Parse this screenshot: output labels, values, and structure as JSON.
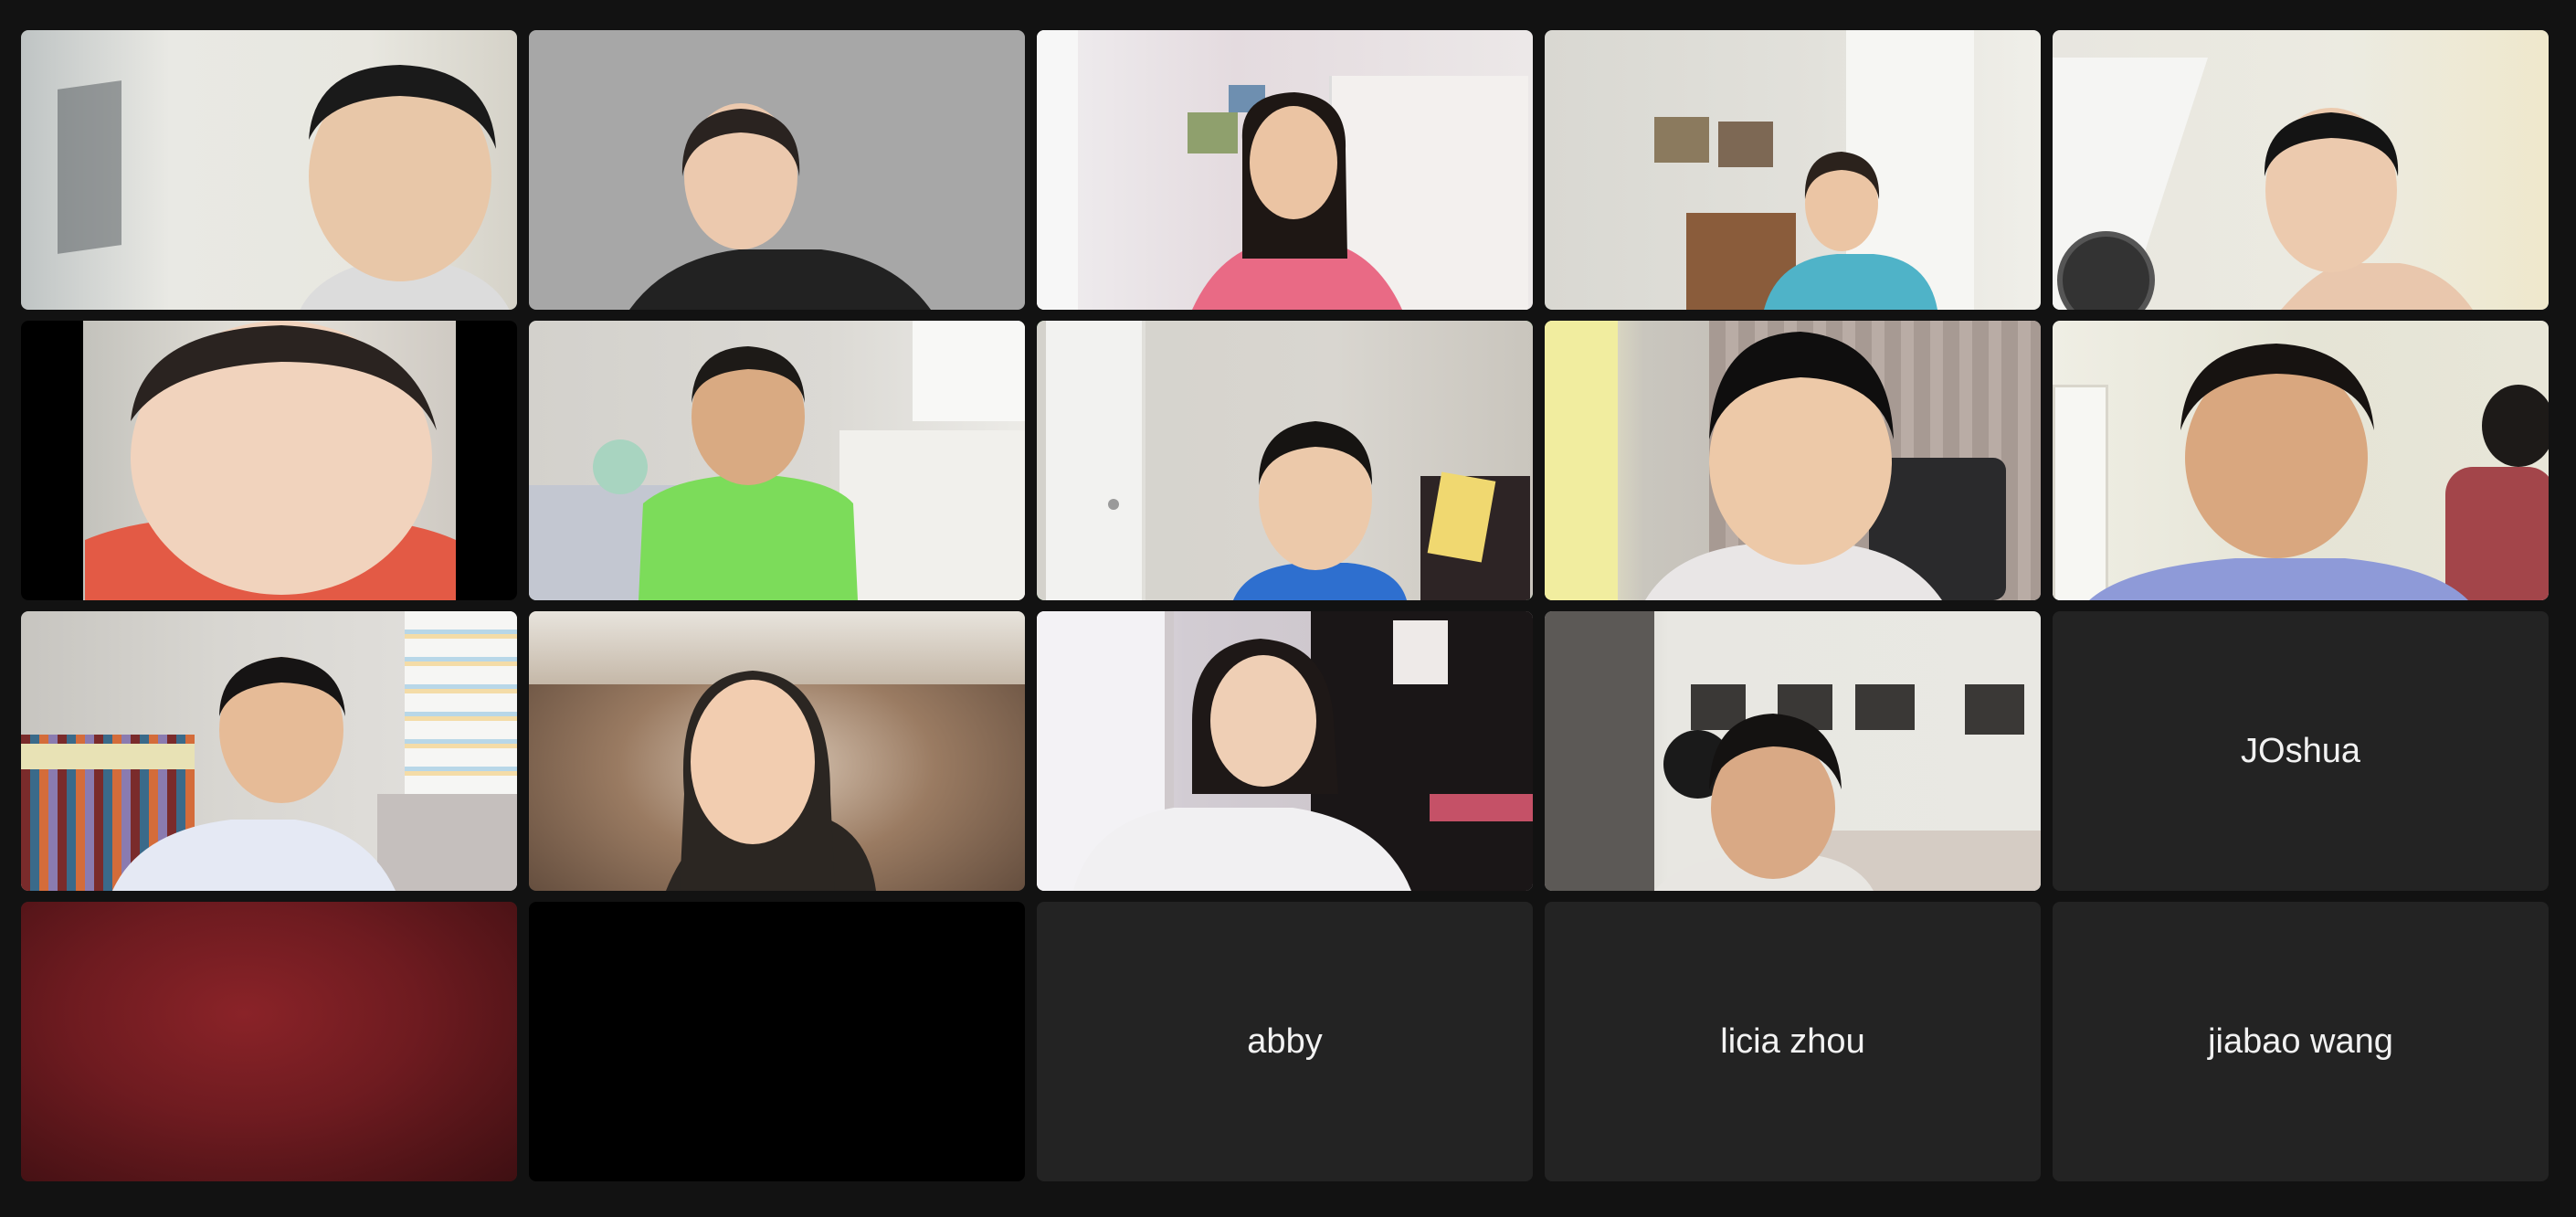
{
  "meeting": {
    "view": "gallery",
    "active_speaker_index": 7
  },
  "colors": {
    "background": "#121212",
    "tile_bg": "#232323",
    "active_outline": "#5fd068",
    "name_text": "#f2f2f2"
  },
  "participants": [
    {
      "type": "video",
      "name": "",
      "bg": "#e3e3df"
    },
    {
      "type": "video",
      "name": "",
      "bg": "#a6a6a6"
    },
    {
      "type": "video",
      "name": "",
      "bg": "#e8e1e4"
    },
    {
      "type": "video",
      "name": "",
      "bg": "#d9d8d2"
    },
    {
      "type": "video",
      "name": "",
      "bg": "#eeeee5"
    },
    {
      "type": "video",
      "name": "",
      "bg": "#000000"
    },
    {
      "type": "video",
      "name": "",
      "bg": "#d8d6d1"
    },
    {
      "type": "video",
      "name": "",
      "bg": "#d7d5d0"
    },
    {
      "type": "video",
      "name": "",
      "bg": "#c9c6be"
    },
    {
      "type": "video",
      "name": "",
      "bg": "#e2e1d6"
    },
    {
      "type": "video",
      "name": "",
      "bg": "#d5d4d0"
    },
    {
      "type": "video",
      "name": "",
      "bg": "#6b5a4a"
    },
    {
      "type": "video",
      "name": "",
      "bg": "#cfc9cc"
    },
    {
      "type": "video",
      "name": "",
      "bg": "#dcdcd6"
    },
    {
      "type": "name",
      "name": "JOshua"
    },
    {
      "type": "video",
      "name": "",
      "bg": "#7a1d22"
    },
    {
      "type": "video",
      "name": "",
      "bg": "#000000"
    },
    {
      "type": "name",
      "name": "abby"
    },
    {
      "type": "name",
      "name": "licia zhou"
    },
    {
      "type": "name",
      "name": "jiabao wang"
    }
  ]
}
